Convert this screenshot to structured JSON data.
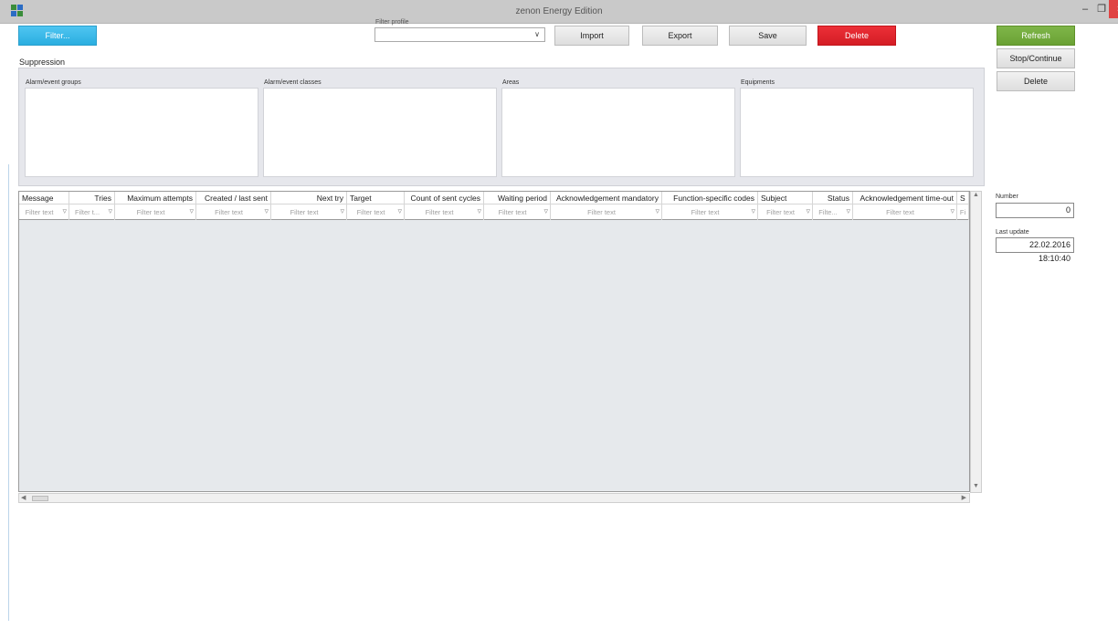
{
  "window": {
    "title": "zenon Energy Edition",
    "min": "–",
    "max": "❐",
    "close": "×"
  },
  "toolbar": {
    "filter_label": "Filter...",
    "filter_profile_label": "Filter profile",
    "filter_profile_value": "",
    "import_label": "Import",
    "export_label": "Export",
    "save_label": "Save",
    "delete_label": "Delete",
    "refresh_label": "Refresh",
    "stop_continue_label": "Stop/Continue",
    "delete2_label": "Delete"
  },
  "suppression": {
    "title": "Suppression",
    "columns": [
      "Alarm/event groups",
      "Alarm/event classes",
      "Areas",
      "Equipments"
    ]
  },
  "grid": {
    "columns": [
      "Message",
      "Tries",
      "Maximum attempts",
      "Created / last sent",
      "Next try",
      "Target",
      "Count of sent cycles",
      "Waiting period",
      "Acknowledgement mandatory",
      "Function-specific codes",
      "Subject",
      "Status",
      "Acknowledgement time-out",
      "S"
    ],
    "filter_placeholders": [
      "Filter text",
      "Filter t...",
      "Filter text",
      "Filter text",
      "Filter text",
      "Filter text",
      "Filter text",
      "Filter text",
      "Filter text",
      "Filter text",
      "Filter text",
      "Filte...",
      "Filter text",
      "Fi"
    ]
  },
  "side": {
    "number_label": "Number",
    "number_value": "0",
    "last_update_label": "Last update",
    "last_update_value": "22.02.2016 18:10:40"
  },
  "icons": {
    "filter": "funnel-icon",
    "dropdown": "chevron-down-icon"
  },
  "colors": {
    "filter_btn": "#2aaee0",
    "delete_btn": "#d41d25",
    "refresh_btn": "#6aa234"
  }
}
